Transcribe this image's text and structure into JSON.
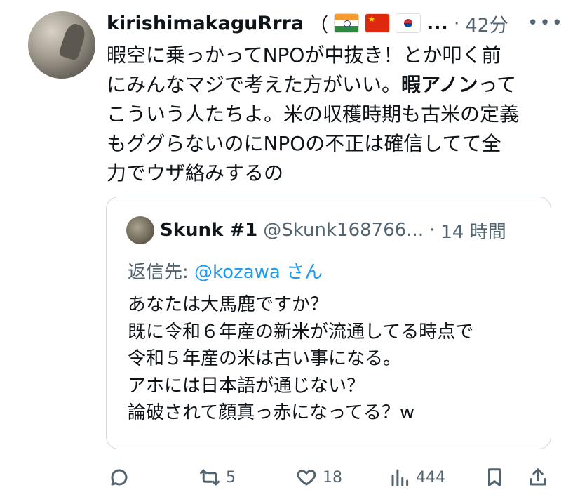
{
  "author": {
    "display_name": "kirishimakaguRrra",
    "paren": "（",
    "flags": [
      "india-flag",
      "china-flag",
      "south-korea-flag"
    ],
    "ellipsis": "...",
    "separator": "·",
    "time": "42分"
  },
  "tweet": {
    "lines": [
      {
        "pre": "暇空に乗っかってNPOが中抜き！とか叩く前",
        "bold": "",
        "post": ""
      },
      {
        "pre": "にみんなマジで考えた方がいい。",
        "bold": "暇アノン",
        "post": "って"
      },
      {
        "pre": "こういう人たちよ。米の収穫時期も古米の定義",
        "bold": "",
        "post": ""
      },
      {
        "pre": "もググらないのにNPOの不正は確信してて全",
        "bold": "",
        "post": ""
      },
      {
        "pre": "力でウザ絡みするの",
        "bold": "",
        "post": ""
      }
    ]
  },
  "quote": {
    "display_name": "Skunk #1",
    "handle": "@Skunk168766...",
    "separator": "·",
    "time": "14 時間",
    "reply_label": "返信先:",
    "reply_mention": "@kozawa",
    "reply_suffix": "さん",
    "lines": [
      "あなたは大馬鹿ですか？",
      "既に令和６年産の新米が流通してる時点で",
      "令和５年産の米は古い事になる。",
      "アホには日本語が通じない？",
      "論破されて顔真っ赤になってる？w"
    ]
  },
  "actions": {
    "reply": {
      "icon": "reply-icon",
      "count": ""
    },
    "retweet": {
      "icon": "retweet-icon",
      "count": "5"
    },
    "like": {
      "icon": "heart-icon",
      "count": "18"
    },
    "views": {
      "icon": "views-icon",
      "count": "444"
    },
    "bookmark": {
      "icon": "bookmark-icon"
    },
    "share": {
      "icon": "share-icon"
    }
  },
  "colors": {
    "link": "#1d9bf0",
    "muted": "#536471",
    "text": "#0f1419",
    "border": "#cfd9de"
  }
}
